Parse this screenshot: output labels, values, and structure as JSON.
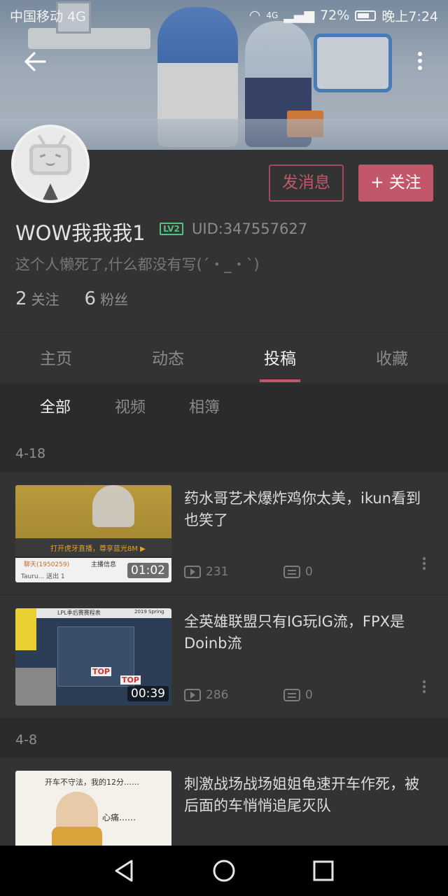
{
  "status_bar": {
    "carrier": "中国移动 4G",
    "network": "4G",
    "battery": "72%",
    "time": "晚上7:24"
  },
  "header": {
    "back_icon": "arrow-left-icon",
    "more_icon": "more-vertical-icon"
  },
  "profile": {
    "username": "WOW我我我1",
    "level": "LV2",
    "uid": "UID:347557627",
    "bio": "这个人懒死了,什么都没有写(´・_・`)",
    "following_count": "2",
    "following_label": "关注",
    "followers_count": "6",
    "followers_label": "粉丝",
    "message_button": "发消息",
    "follow_button": "+ 关注"
  },
  "tabs": [
    "主页",
    "动态",
    "投稿",
    "收藏"
  ],
  "active_tab": "投稿",
  "subtabs": [
    "全部",
    "视频",
    "相簿"
  ],
  "active_subtab": "全部",
  "groups": [
    {
      "date": "4-18",
      "items": [
        {
          "title": "药水哥艺术爆炸鸡你太美，ikun看到也笑了",
          "duration": "01:02",
          "views": "231",
          "danmaku": "0",
          "thumb_text": [
            "打开虎牙直播，尊享蓝光8M ▶",
            "聊天(1950259)",
            "主播信息",
            "Tauru... 送出 1"
          ]
        },
        {
          "title": "全英雄联盟只有IG玩IG流，FPX是Doinb流",
          "duration": "00:39",
          "views": "286",
          "danmaku": "0",
          "thumb_text": [
            "LPL季后赛赛程表",
            "2019 Spring",
            "TOP",
            "TOP"
          ]
        }
      ]
    },
    {
      "date": "4-8",
      "items": [
        {
          "title": "刺激战场战场姐姐龟速开车作死，被后面的车悄悄追尾灭队",
          "duration": "",
          "views": "",
          "danmaku": "",
          "thumb_text": [
            "开车不守法，我的12分……",
            "心痛……"
          ]
        }
      ]
    }
  ],
  "colors": {
    "accent": "#c2576a",
    "background": "#2f2f2f",
    "level_green": "#55c27d"
  }
}
